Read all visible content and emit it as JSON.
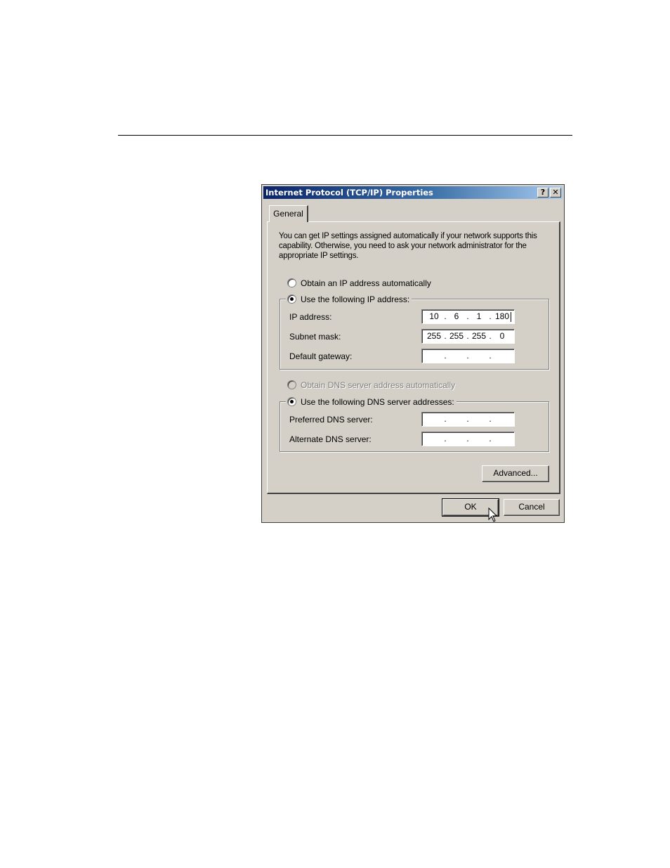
{
  "dialog": {
    "title": "Internet Protocol (TCP/IP) Properties",
    "help_glyph": "?",
    "close_glyph": "✕"
  },
  "tabs": [
    {
      "label": "General",
      "selected": true
    }
  ],
  "intro_text": "You can get IP settings assigned automatically if your network supports this capability. Otherwise, you need to ask your network administrator for the appropriate IP settings.",
  "ip_section": {
    "obtain_auto_label": "Obtain an IP address automatically",
    "obtain_auto_selected": false,
    "use_following_label": "Use the following IP address:",
    "use_following_selected": true,
    "fields": [
      {
        "label": "IP address:",
        "octets": [
          "10",
          "6",
          "1",
          "180"
        ]
      },
      {
        "label": "Subnet mask:",
        "octets": [
          "255",
          "255",
          "255",
          "0"
        ]
      },
      {
        "label": "Default gateway:",
        "octets": [
          "",
          "",
          "",
          ""
        ]
      }
    ]
  },
  "dns_section": {
    "obtain_auto_label": "Obtain DNS server address automatically",
    "obtain_auto_selected": false,
    "obtain_auto_disabled": true,
    "use_following_label": "Use the following DNS server addresses:",
    "use_following_selected": true,
    "fields": [
      {
        "label": "Preferred DNS server:",
        "octets": [
          "",
          "",
          "",
          ""
        ]
      },
      {
        "label": "Alternate DNS server:",
        "octets": [
          "",
          "",
          "",
          ""
        ]
      }
    ]
  },
  "buttons": {
    "advanced": "Advanced...",
    "ok": "OK",
    "cancel": "Cancel"
  },
  "ip_dot": ".",
  "colors": {
    "dialog_face": "#d4d0c8",
    "titlebar_start": "#0a246a",
    "titlebar_end": "#a6caf0"
  }
}
